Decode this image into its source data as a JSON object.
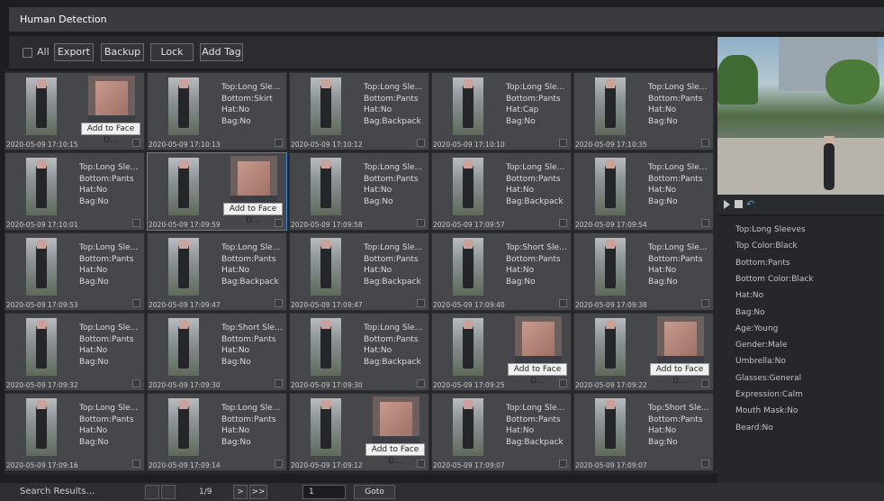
{
  "window": {
    "title": "Human Detection"
  },
  "toolbar": {
    "all_label": "All",
    "buttons": [
      "Export",
      "Backup",
      "Lock",
      "Add Tag"
    ]
  },
  "face_button_label": "Add to Face D...",
  "cards": [
    {
      "type": "face",
      "timestamp": "2020-05-09 17:10:15"
    },
    {
      "type": "attrs",
      "attrs": [
        "Top:Long Sle...",
        "Bottom:Skirt",
        "Hat:No",
        "Bag:No"
      ],
      "timestamp": "2020-05-09 17:10:13"
    },
    {
      "type": "attrs",
      "attrs": [
        "Top:Long Sle...",
        "Bottom:Pants",
        "Hat:No",
        "Bag:Backpack"
      ],
      "timestamp": "2020-05-09 17:10:12"
    },
    {
      "type": "attrs",
      "attrs": [
        "Top:Long Sle...",
        "Bottom:Pants",
        "Hat:Cap",
        "Bag:No"
      ],
      "timestamp": "2020-05-09 17:10:10"
    },
    {
      "type": "attrs",
      "attrs": [
        "Top:Long Sle...",
        "Bottom:Pants",
        "Hat:No",
        "Bag:No"
      ],
      "timestamp": "2020-05-09 17:10:35"
    },
    {
      "type": "attrs",
      "attrs": [
        "Top:Long Sle...",
        "Bottom:Pants",
        "Hat:No",
        "Bag:No"
      ],
      "timestamp": "2020-05-09 17:10:01"
    },
    {
      "type": "face",
      "timestamp": "2020-05-09 17:09:59",
      "selected": true
    },
    {
      "type": "attrs",
      "attrs": [
        "Top:Long Sle...",
        "Bottom:Pants",
        "Hat:No",
        "Bag:No"
      ],
      "timestamp": "2020-05-09 17:09:58"
    },
    {
      "type": "attrs",
      "attrs": [
        "Top:Long Sle...",
        "Bottom:Pants",
        "Hat:No",
        "Bag:Backpack"
      ],
      "timestamp": "2020-05-09 17:09:57"
    },
    {
      "type": "attrs",
      "attrs": [
        "Top:Long Sle...",
        "Bottom:Pants",
        "Hat:No",
        "Bag:No"
      ],
      "timestamp": "2020-05-09 17:09:54"
    },
    {
      "type": "attrs",
      "attrs": [
        "Top:Long Sle...",
        "Bottom:Pants",
        "Hat:No",
        "Bag:No"
      ],
      "timestamp": "2020-05-09 17:09:53"
    },
    {
      "type": "attrs",
      "attrs": [
        "Top:Long Sle...",
        "Bottom:Pants",
        "Hat:No",
        "Bag:Backpack"
      ],
      "timestamp": "2020-05-09 17:09:47"
    },
    {
      "type": "attrs",
      "attrs": [
        "Top:Long Sle...",
        "Bottom:Pants",
        "Hat:No",
        "Bag:Backpack"
      ],
      "timestamp": "2020-05-09 17:09:47"
    },
    {
      "type": "attrs",
      "attrs": [
        "Top:Short Sle...",
        "Bottom:Pants",
        "Hat:No",
        "Bag:No"
      ],
      "timestamp": "2020-05-09 17:09:40"
    },
    {
      "type": "attrs",
      "attrs": [
        "Top:Long Sle...",
        "Bottom:Pants",
        "Hat:No",
        "Bag:No"
      ],
      "timestamp": "2020-05-09 17:09:38"
    },
    {
      "type": "attrs",
      "attrs": [
        "Top:Long Sle...",
        "Bottom:Pants",
        "Hat:No",
        "Bag:No"
      ],
      "timestamp": "2020-05-09 17:09:32"
    },
    {
      "type": "attrs",
      "attrs": [
        "Top:Short Sle...",
        "Bottom:Pants",
        "Hat:No",
        "Bag:No"
      ],
      "timestamp": "2020-05-09 17:09:30"
    },
    {
      "type": "attrs",
      "attrs": [
        "Top:Long Sle...",
        "Bottom:Pants",
        "Hat:No",
        "Bag:Backpack"
      ],
      "timestamp": "2020-05-09 17:09:30"
    },
    {
      "type": "face",
      "timestamp": "2020-05-09 17:09:25"
    },
    {
      "type": "face",
      "timestamp": "2020-05-09 17:09:22"
    },
    {
      "type": "attrs",
      "attrs": [
        "Top:Long Sle...",
        "Bottom:Pants",
        "Hat:No",
        "Bag:No"
      ],
      "timestamp": "2020-05-09 17:09:16"
    },
    {
      "type": "attrs",
      "attrs": [
        "Top:Long Sle...",
        "Bottom:Pants",
        "Hat:No",
        "Bag:No"
      ],
      "timestamp": "2020-05-09 17:09:14"
    },
    {
      "type": "face",
      "timestamp": "2020-05-09 17:09:12"
    },
    {
      "type": "attrs",
      "attrs": [
        "Top:Long Sle...",
        "Bottom:Pants",
        "Hat:No",
        "Bag:Backpack"
      ],
      "timestamp": "2020-05-09 17:09:07"
    },
    {
      "type": "attrs",
      "attrs": [
        "Top:Short Sle...",
        "Bottom:Pants",
        "Hat:No",
        "Bag:No"
      ],
      "timestamp": "2020-05-09 17:09:07"
    }
  ],
  "details": [
    "Top:Long Sleeves",
    "Top Color:Black",
    "Bottom:Pants",
    "Bottom Color:Black",
    "Hat:No",
    "Bag:No",
    "Age:Young",
    "Gender:Male",
    "Umbrella:No",
    "Glasses:General",
    "Expression:Calm",
    "Mouth Mask:No",
    "Beard:No"
  ],
  "footer": {
    "search_results": "Search Results...",
    "page_indicator": "1/9",
    "next_label": ">",
    "last_label": ">>",
    "page_input": "1",
    "goto_label": "Goto"
  },
  "colors": {
    "accent": "#3d86d6",
    "play_accent": "#4aa3e0"
  },
  "icons": [
    "play-icon",
    "stop-icon",
    "rewind-icon"
  ]
}
